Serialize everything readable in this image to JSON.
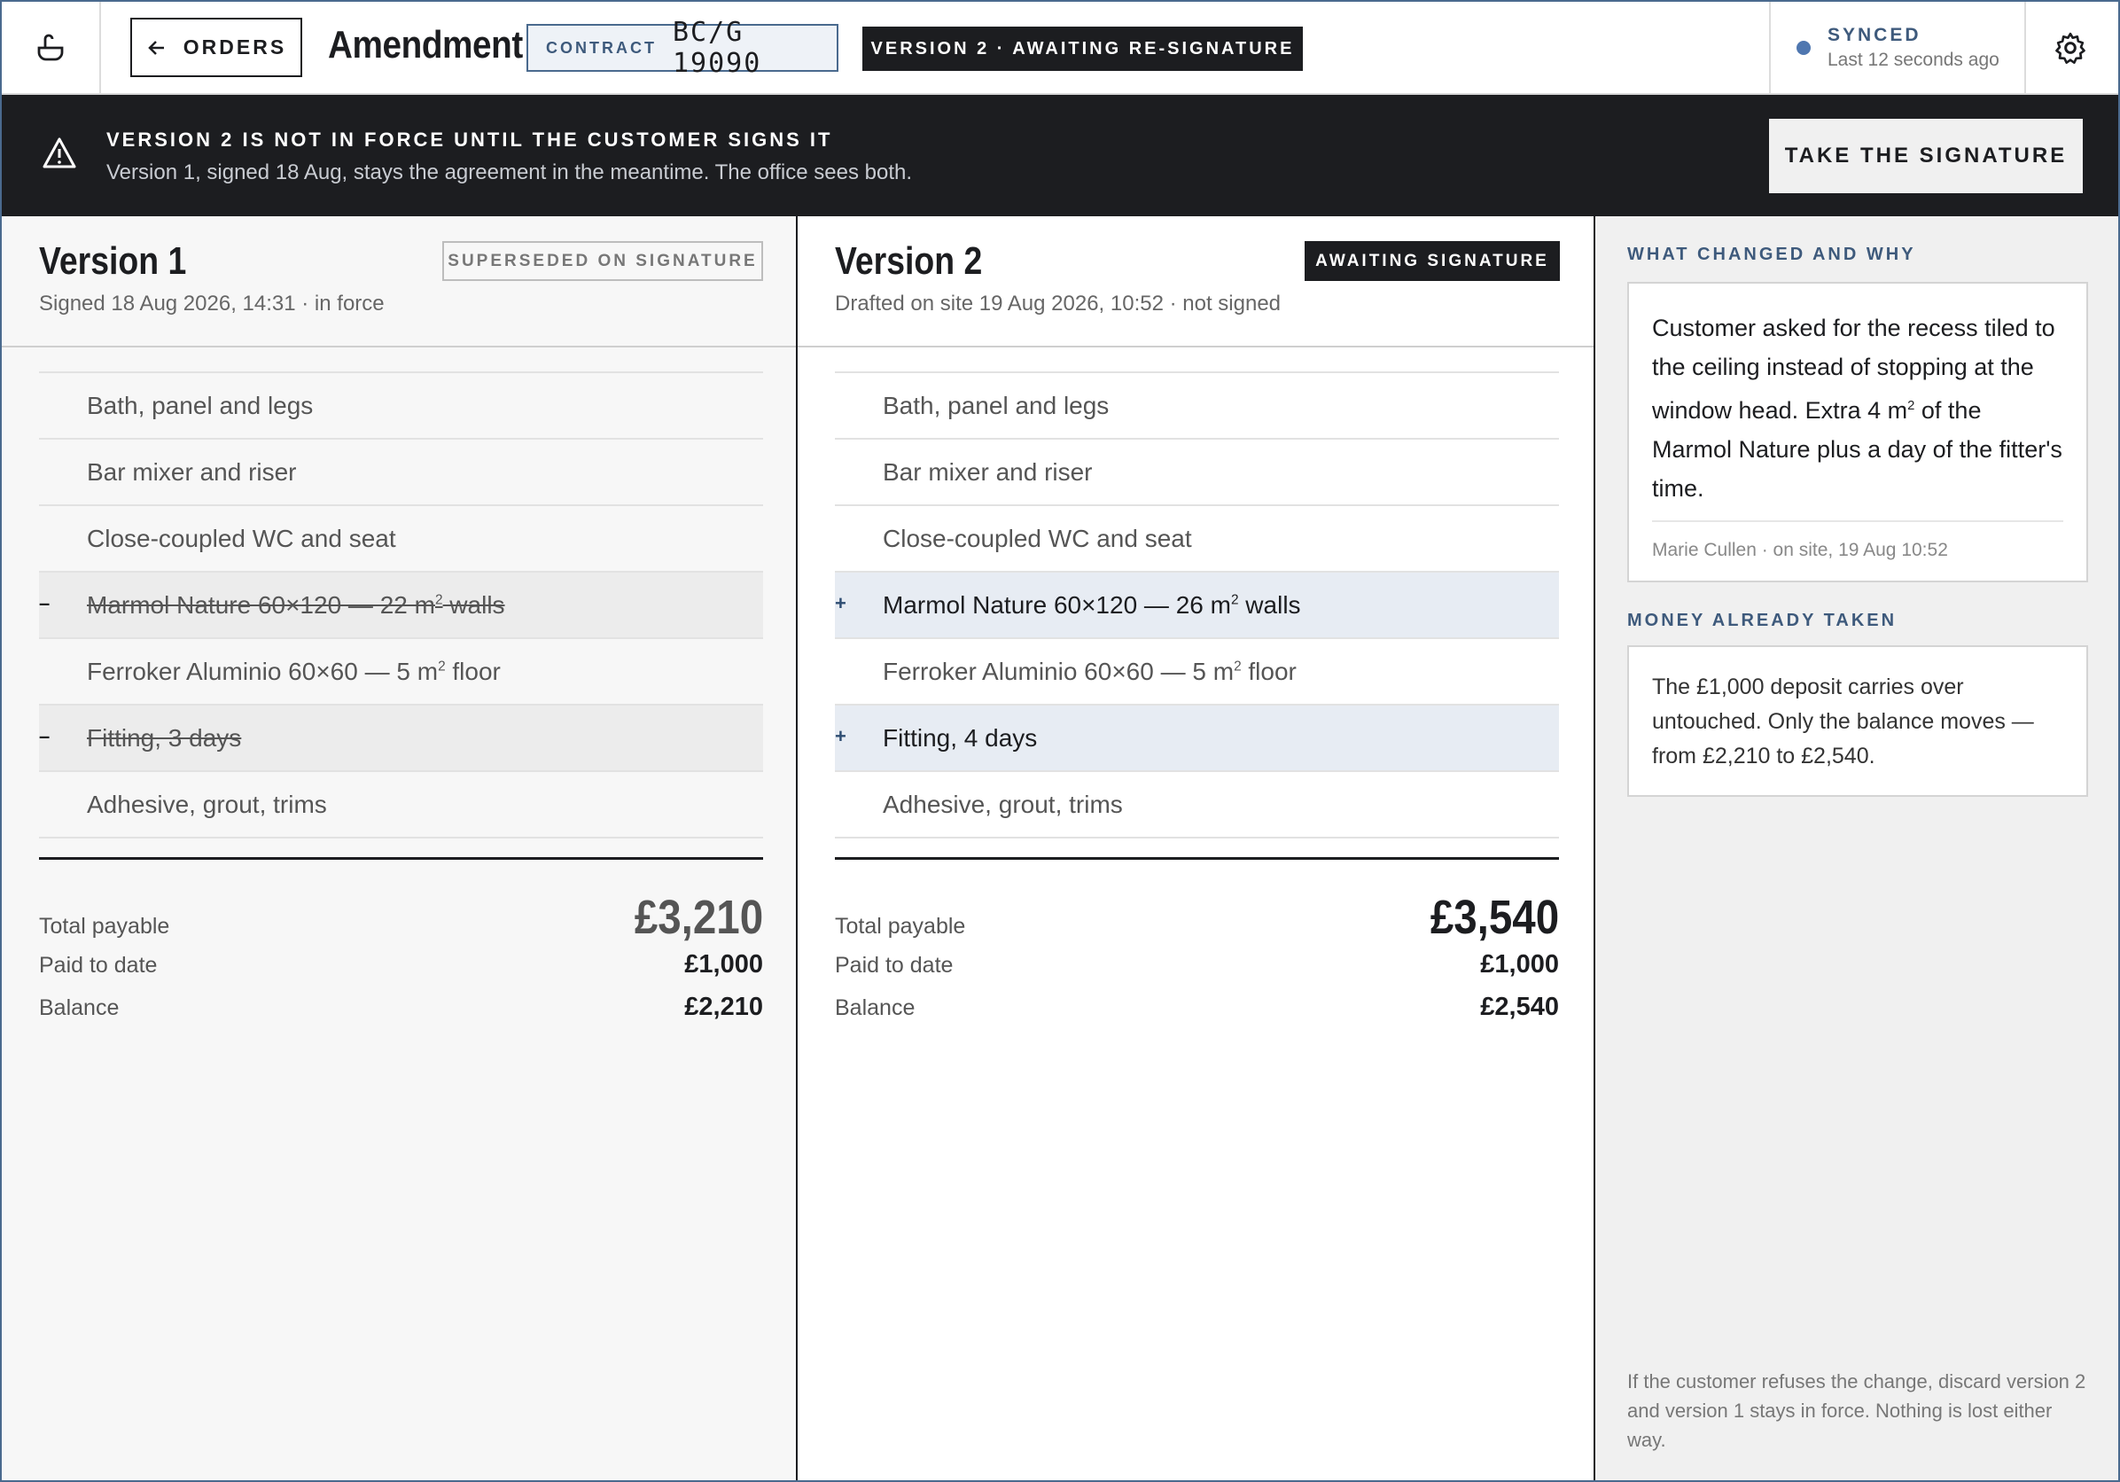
{
  "header": {
    "orders_label": "ORDERS",
    "title": "Amendment",
    "contract_key": "CONTRACT",
    "contract_value": "BC/G 19090",
    "version_tag": "VERSION 2 · AWAITING RE-SIGNATURE",
    "sync_status": "SYNCED",
    "sync_time": "Last 12 seconds ago",
    "icons": {
      "left": "sink-icon",
      "back": "arrow-left-icon",
      "settings": "gear-icon"
    }
  },
  "banner": {
    "title": "VERSION 2 IS NOT IN FORCE UNTIL THE CUSTOMER SIGNS IT",
    "text": "Version 1, signed 18 Aug, stays the agreement in the meantime. The office sees both.",
    "button": "TAKE THE SIGNATURE",
    "icon": "warning-icon"
  },
  "version1": {
    "title": "Version 1",
    "subtitle": "Signed 18 Aug 2026, 14:31 · in force",
    "badge": "SUPERSEDED ON SIGNATURE",
    "items": [
      {
        "marker": "",
        "pre": "Bath, panel and legs",
        "sup": "",
        "post": "",
        "state": "unchanged"
      },
      {
        "marker": "",
        "pre": "Bar mixer and riser",
        "sup": "",
        "post": "",
        "state": "unchanged"
      },
      {
        "marker": "",
        "pre": "Close-coupled WC and seat",
        "sup": "",
        "post": "",
        "state": "unchanged"
      },
      {
        "marker": "–",
        "pre": "Marmol Nature 60×120 — 22 m",
        "sup": "2",
        "post": " walls",
        "state": "removed"
      },
      {
        "marker": "",
        "pre": "Ferroker Aluminio 60×60 — 5 m",
        "sup": "2",
        "post": " floor",
        "state": "unchanged"
      },
      {
        "marker": "–",
        "pre": "Fitting, 3 days",
        "sup": "",
        "post": "",
        "state": "removed"
      },
      {
        "marker": "",
        "pre": "Adhesive, grout, trims",
        "sup": "",
        "post": "",
        "state": "unchanged"
      }
    ],
    "totals": {
      "total_label": "Total payable",
      "total": "£3,210",
      "paid_label": "Paid to date",
      "paid": "£1,000",
      "balance_label": "Balance",
      "balance": "£2,210"
    }
  },
  "version2": {
    "title": "Version 2",
    "subtitle": "Drafted on site 19 Aug 2026, 10:52 · not signed",
    "badge": "AWAITING SIGNATURE",
    "items": [
      {
        "marker": "",
        "pre": "Bath, panel and legs",
        "sup": "",
        "post": "",
        "state": "unchanged"
      },
      {
        "marker": "",
        "pre": "Bar mixer and riser",
        "sup": "",
        "post": "",
        "state": "unchanged"
      },
      {
        "marker": "",
        "pre": "Close-coupled WC and seat",
        "sup": "",
        "post": "",
        "state": "unchanged"
      },
      {
        "marker": "+",
        "pre": "Marmol Nature 60×120 — 26 m",
        "sup": "2",
        "post": " walls",
        "state": "added"
      },
      {
        "marker": "",
        "pre": "Ferroker Aluminio 60×60 — 5 m",
        "sup": "2",
        "post": " floor",
        "state": "unchanged"
      },
      {
        "marker": "+",
        "pre": "Fitting, 4 days",
        "sup": "",
        "post": "",
        "state": "added"
      },
      {
        "marker": "",
        "pre": "Adhesive, grout, trims",
        "sup": "",
        "post": "",
        "state": "unchanged"
      }
    ],
    "totals": {
      "total_label": "Total payable",
      "total": "£3,540",
      "paid_label": "Paid to date",
      "paid": "£1,000",
      "balance_label": "Balance",
      "balance": "£2,540"
    }
  },
  "sidebar": {
    "why_heading": "WHAT CHANGED AND WHY",
    "why_pre": "Customer asked for the recess tiled to the ceiling instead of stopping at the window head. Extra 4 m",
    "why_sup": "2",
    "why_post": " of the Marmol Nature plus a day of the fitter's time.",
    "why_meta": "Marie Cullen · on site, 19 Aug 10:52",
    "money_heading": "MONEY ALREADY TAKEN",
    "money_text": "The £1,000 deposit carries over untouched. Only the balance moves — from £2,210 to £2,540.",
    "footnote": "If the customer refuses the change, discard version 2 and version 1 stays in force. Nothing is lost either way."
  },
  "colors": {
    "ink": "#1c1d20",
    "accent": "#3e5a7c",
    "added_bg": "#e7ecf3",
    "removed_bg": "#ececec",
    "sync_dot": "#4f77b0"
  }
}
